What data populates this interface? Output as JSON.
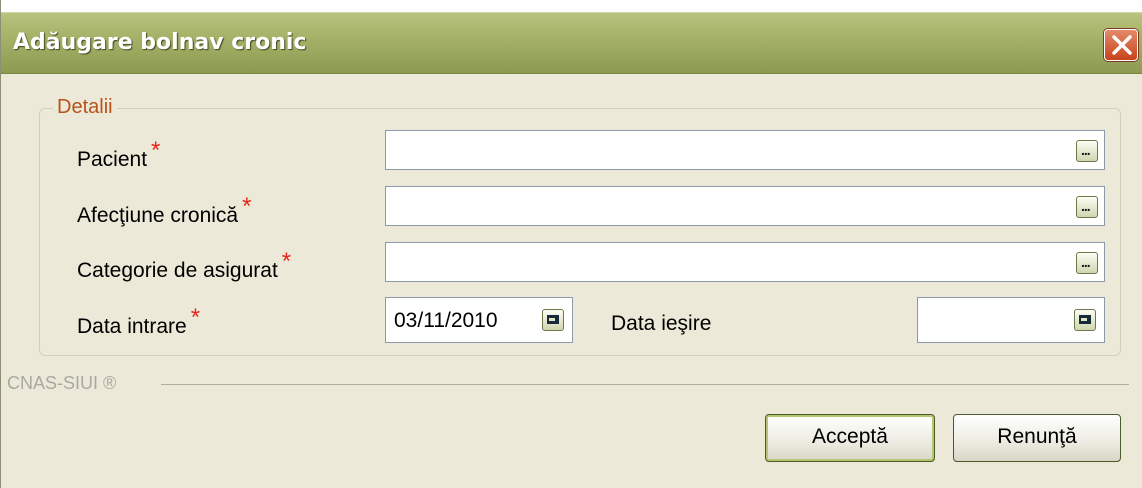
{
  "window": {
    "title": "Adăugare bolnav cronic",
    "close_icon": "close-icon"
  },
  "group": {
    "legend": "Detalii"
  },
  "fields": {
    "pacient": {
      "label": "Pacient",
      "required": "*",
      "value": ""
    },
    "afectiune": {
      "label": "Afecţiune cronică",
      "required": "*",
      "value": ""
    },
    "categorie": {
      "label": "Categorie de asigurat",
      "required": "*",
      "value": ""
    },
    "ellipsis": "..."
  },
  "dates": {
    "intrare": {
      "label": "Data intrare",
      "required": "*",
      "value": "03/11/2010"
    },
    "iesire": {
      "label": "Data ieşire",
      "value": ""
    }
  },
  "footer": {
    "brand": "CNAS-SIUI ®"
  },
  "buttons": {
    "accept": "Acceptă",
    "cancel": "Renunţă"
  },
  "colors": {
    "titlebar": "#a5b268",
    "window_bg": "#ece9d8",
    "legend": "#b8531b",
    "required": "#e8241a",
    "close": "#c8421c"
  }
}
